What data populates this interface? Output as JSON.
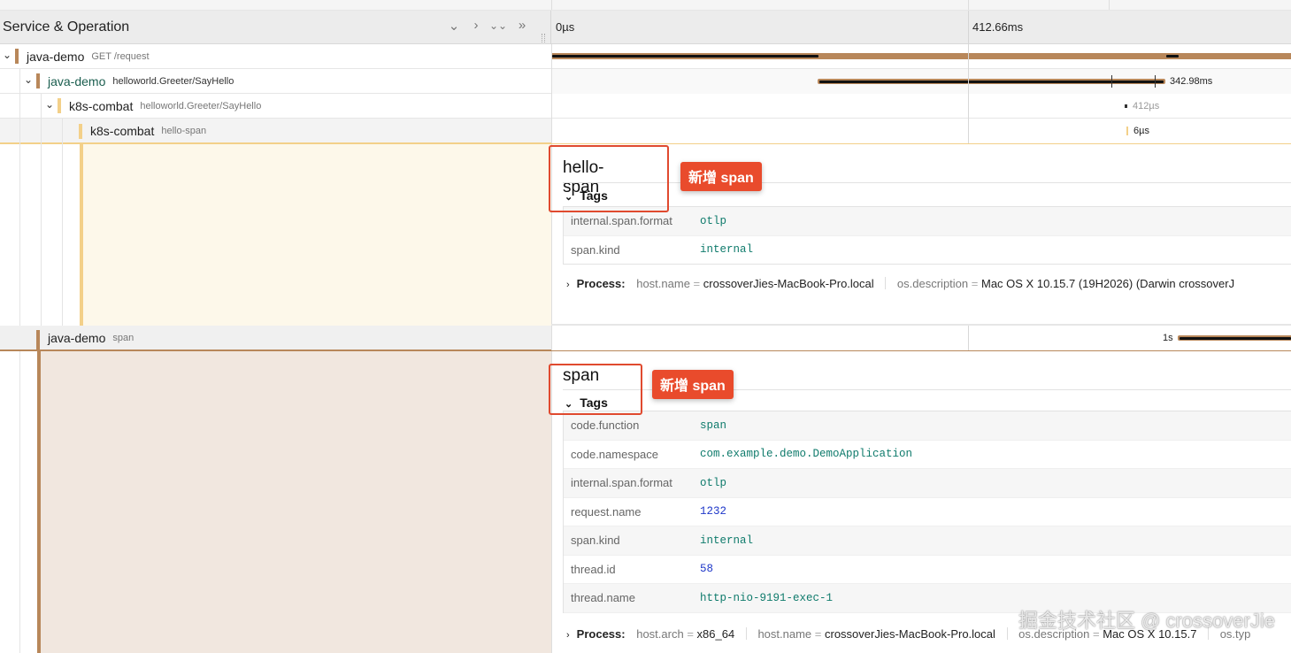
{
  "header": {
    "title": "Service & Operation",
    "controls": [
      "⌄",
      "›",
      "⌄⌄",
      "»"
    ],
    "ticks": [
      "0µs",
      "412.66ms"
    ]
  },
  "rows": [
    {
      "service": "java-demo",
      "operation": "GET /request",
      "color": "#b8875a",
      "duration": ""
    },
    {
      "service": "java-demo",
      "operation": "helloworld.Greeter/SayHello",
      "color": "#b8875a",
      "duration": "342.98ms"
    },
    {
      "service": "k8s-combat",
      "operation": "helloworld.Greeter/SayHello",
      "color": "#f3d089",
      "duration": "412µs"
    },
    {
      "service": "k8s-combat",
      "operation": "hello-span",
      "color": "#f3d089",
      "duration": "6µs"
    },
    {
      "service": "java-demo",
      "operation": "span",
      "color": "#b8875a",
      "duration": "1s"
    }
  ],
  "detail1": {
    "title": "hello-span",
    "tags_label": "Tags",
    "badge": "新增 span",
    "tags": [
      {
        "key": "internal.span.format",
        "value": "otlp"
      },
      {
        "key": "span.kind",
        "value": "internal"
      }
    ],
    "process_label": "Process:",
    "process": [
      {
        "key": "host.name",
        "value": "crossoverJies-MacBook-Pro.local"
      },
      {
        "key": "os.description",
        "value": "Mac OS X 10.15.7 (19H2026) (Darwin crossoverJ"
      }
    ]
  },
  "detail2": {
    "title": "span",
    "tags_label": "Tags",
    "badge": "新增 span",
    "tags": [
      {
        "key": "code.function",
        "value": "span"
      },
      {
        "key": "code.namespace",
        "value": "com.example.demo.DemoApplication"
      },
      {
        "key": "internal.span.format",
        "value": "otlp"
      },
      {
        "key": "request.name",
        "value": "1232"
      },
      {
        "key": "span.kind",
        "value": "internal"
      },
      {
        "key": "thread.id",
        "value": "58"
      },
      {
        "key": "thread.name",
        "value": "http-nio-9191-exec-1"
      }
    ],
    "process_label": "Process:",
    "process": [
      {
        "key": "host.arch",
        "value": "x86_64"
      },
      {
        "key": "host.name",
        "value": "crossoverJies-MacBook-Pro.local"
      },
      {
        "key": "os.description",
        "value": "Mac OS X 10.15.7"
      },
      {
        "key": "os.typ",
        "value": ""
      }
    ]
  },
  "watermark": "掘金技术社区 @ crossoverJie",
  "colors": {
    "java_demo": "#b8875a",
    "k8s_combat": "#f3d089",
    "badge": "#e94b2c",
    "tag_value": "#0f7b6c"
  }
}
